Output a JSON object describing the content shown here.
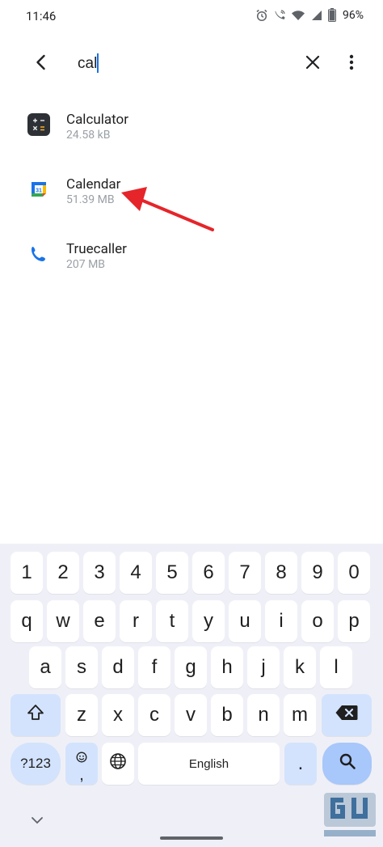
{
  "status_bar": {
    "time": "11:46",
    "battery": "96%",
    "icons": [
      "alarm-icon",
      "wifi-calling-icon",
      "wifi-icon",
      "signal-icon",
      "battery-icon"
    ]
  },
  "search": {
    "query": "cal",
    "icons": [
      "back-arrow-icon",
      "close-icon",
      "more-vert-icon"
    ]
  },
  "results": [
    {
      "name": "Calculator",
      "size": "24.58 kB",
      "icon": "calculator-app-icon"
    },
    {
      "name": "Calendar",
      "size": "51.39 MB",
      "icon": "calendar-app-icon",
      "icon_text": "31"
    },
    {
      "name": "Truecaller",
      "size": "207 MB",
      "icon": "phone-app-icon"
    }
  ],
  "annotation": {
    "type": "arrow",
    "color": "#e5252a",
    "target": "Calendar"
  },
  "keyboard": {
    "row_numbers": [
      "1",
      "2",
      "3",
      "4",
      "5",
      "6",
      "7",
      "8",
      "9",
      "0"
    ],
    "row_top": [
      "q",
      "w",
      "e",
      "r",
      "t",
      "y",
      "u",
      "i",
      "o",
      "p"
    ],
    "row_middle": [
      "a",
      "s",
      "d",
      "f",
      "g",
      "h",
      "j",
      "k",
      "l"
    ],
    "row_bottom": [
      "z",
      "x",
      "c",
      "v",
      "b",
      "n",
      "m"
    ],
    "symbols_label": "?123",
    "comma": ",",
    "space_label": "English",
    "period": ".",
    "icons": [
      "shift-icon",
      "backspace-icon",
      "emoji-icon",
      "globe-icon",
      "search-icon",
      "chevron-down-icon"
    ]
  },
  "colors": {
    "accent": "#1a73e8",
    "keyboard_bg": "#eff0f7",
    "function_key": "#d3e3fd",
    "action_key": "#a8c7fa",
    "secondary_text": "#9aa0a6"
  }
}
